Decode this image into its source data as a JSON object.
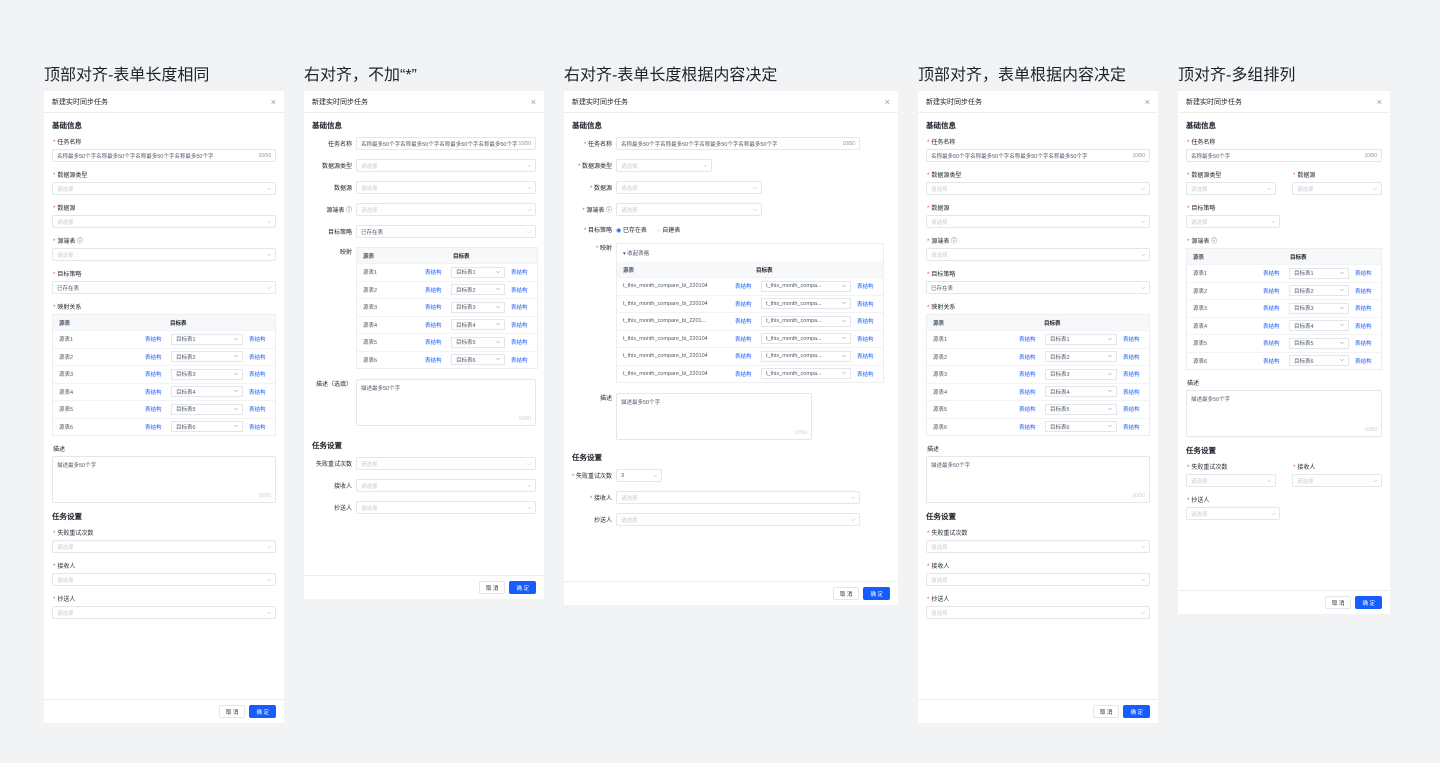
{
  "columns": [
    {
      "title": "顶部对齐-表单长度相同"
    },
    {
      "title": "右对齐，不加“*”"
    },
    {
      "title": "右对齐-表单长度根据内容决定"
    },
    {
      "title": "顶部对齐，表单根据内容决定"
    },
    {
      "title": "顶对齐-多组排列"
    }
  ],
  "dialog": {
    "title": "新建实时同步任务",
    "close": "×",
    "basic": "基础信息",
    "task_settings": "任务设置",
    "task_name": "任务名称",
    "task_name_value": "名称最多50个字名称最多50个字名称最多50个字名称最多50个字",
    "task_name_short": "名称最多50个字",
    "count": "10/50",
    "ds_type": "数据源类型",
    "ds": "数据源",
    "src_table": "源端表 ⓘ",
    "strategy": "目标策略",
    "mapping": "映射关系",
    "mapping_short": "映射",
    "strategy_value": "已存在表",
    "placeholder": "请选择",
    "desc": "描述",
    "desc_optional": "描述（选填）",
    "desc_value": "描述最多50个字",
    "retry": "失败重试次数",
    "receiver": "接收人",
    "cc": "抄送人",
    "retry_value": "3",
    "cancel": "取 消",
    "ok": "确 定",
    "col_src": "源表",
    "col_tgt": "目标表",
    "link": "表结构",
    "radio_exist": "已存在表",
    "radio_auto": "自建表",
    "collapse": "▾ 收起表格"
  },
  "rows": [
    {
      "src": "源表1",
      "tgt": "目标表1"
    },
    {
      "src": "源表2",
      "tgt": "目标表2"
    },
    {
      "src": "源表3",
      "tgt": "目标表3"
    },
    {
      "src": "源表4",
      "tgt": "目标表4"
    },
    {
      "src": "源表5",
      "tgt": "目标表5"
    },
    {
      "src": "源表6",
      "tgt": "目标表6"
    }
  ],
  "long_rows": [
    {
      "src": "t_this_month_compare_bi_220104",
      "tgt": "t_this_month_compa..."
    },
    {
      "src": "t_this_month_compare_bi_220104",
      "tgt": "t_this_month_compa..."
    },
    {
      "src": "t_this_month_compare_bi_2201...",
      "tgt": "t_this_month_compa..."
    },
    {
      "src": "t_this_month_compare_bi_220104",
      "tgt": "t_this_month_compa..."
    },
    {
      "src": "t_this_month_compare_bi_220104",
      "tgt": "t_this_month_compa..."
    },
    {
      "src": "t_this_month_compare_bi_220104",
      "tgt": "t_this_month_compa..."
    }
  ]
}
